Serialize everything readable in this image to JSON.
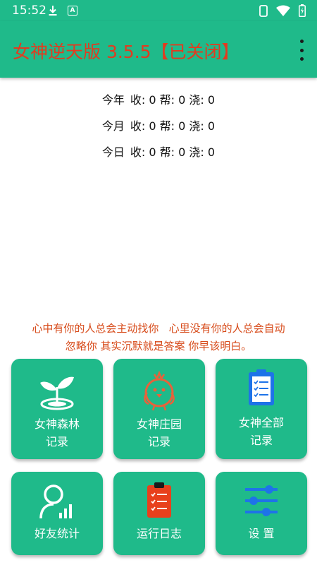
{
  "status_bar": {
    "time": "15:52",
    "download_icon": "download-icon",
    "a_icon": "a-notification-icon",
    "a_icon_text": "A",
    "phone_icon": "phone-icon",
    "wifi_icon": "wifi-icon",
    "battery_icon": "battery-charging-icon"
  },
  "app_bar": {
    "title": "女神逆天版 3.5.5【已关闭】",
    "menu_icon": "more-vertical-icon"
  },
  "stats": [
    {
      "period": "今年",
      "text": "收: 0 帮: 0 浇: 0"
    },
    {
      "period": "今月",
      "text": "收: 0 帮: 0 浇: 0"
    },
    {
      "period": "今日",
      "text": "收: 0 帮: 0 浇: 0"
    }
  ],
  "quote": {
    "line1": "心中有你的人总会主动找你   心里没有你的人总会自动",
    "line2": "忽略你 其实沉默就是答案 你早该明白。"
  },
  "tiles": [
    {
      "line1": "女神森林",
      "line2": "记录",
      "icon": "sprout-icon"
    },
    {
      "line1": "女神庄园",
      "line2": "记录",
      "icon": "chick-icon"
    },
    {
      "line1": "女神全部",
      "line2": "记录",
      "icon": "clipboard-list-icon"
    },
    {
      "line1": "好友统计",
      "line2": "",
      "icon": "user-stats-icon"
    },
    {
      "line1": "运行日志",
      "line2": "",
      "icon": "log-clipboard-icon"
    },
    {
      "line1": "设 置",
      "line2": "",
      "icon": "sliders-icon"
    }
  ],
  "colors": {
    "primary": "#1fba8a",
    "title_red": "#e23b1f",
    "quote_orange": "#d74a19",
    "icon_blue": "#1e73e8",
    "icon_orange": "#e8623a"
  }
}
